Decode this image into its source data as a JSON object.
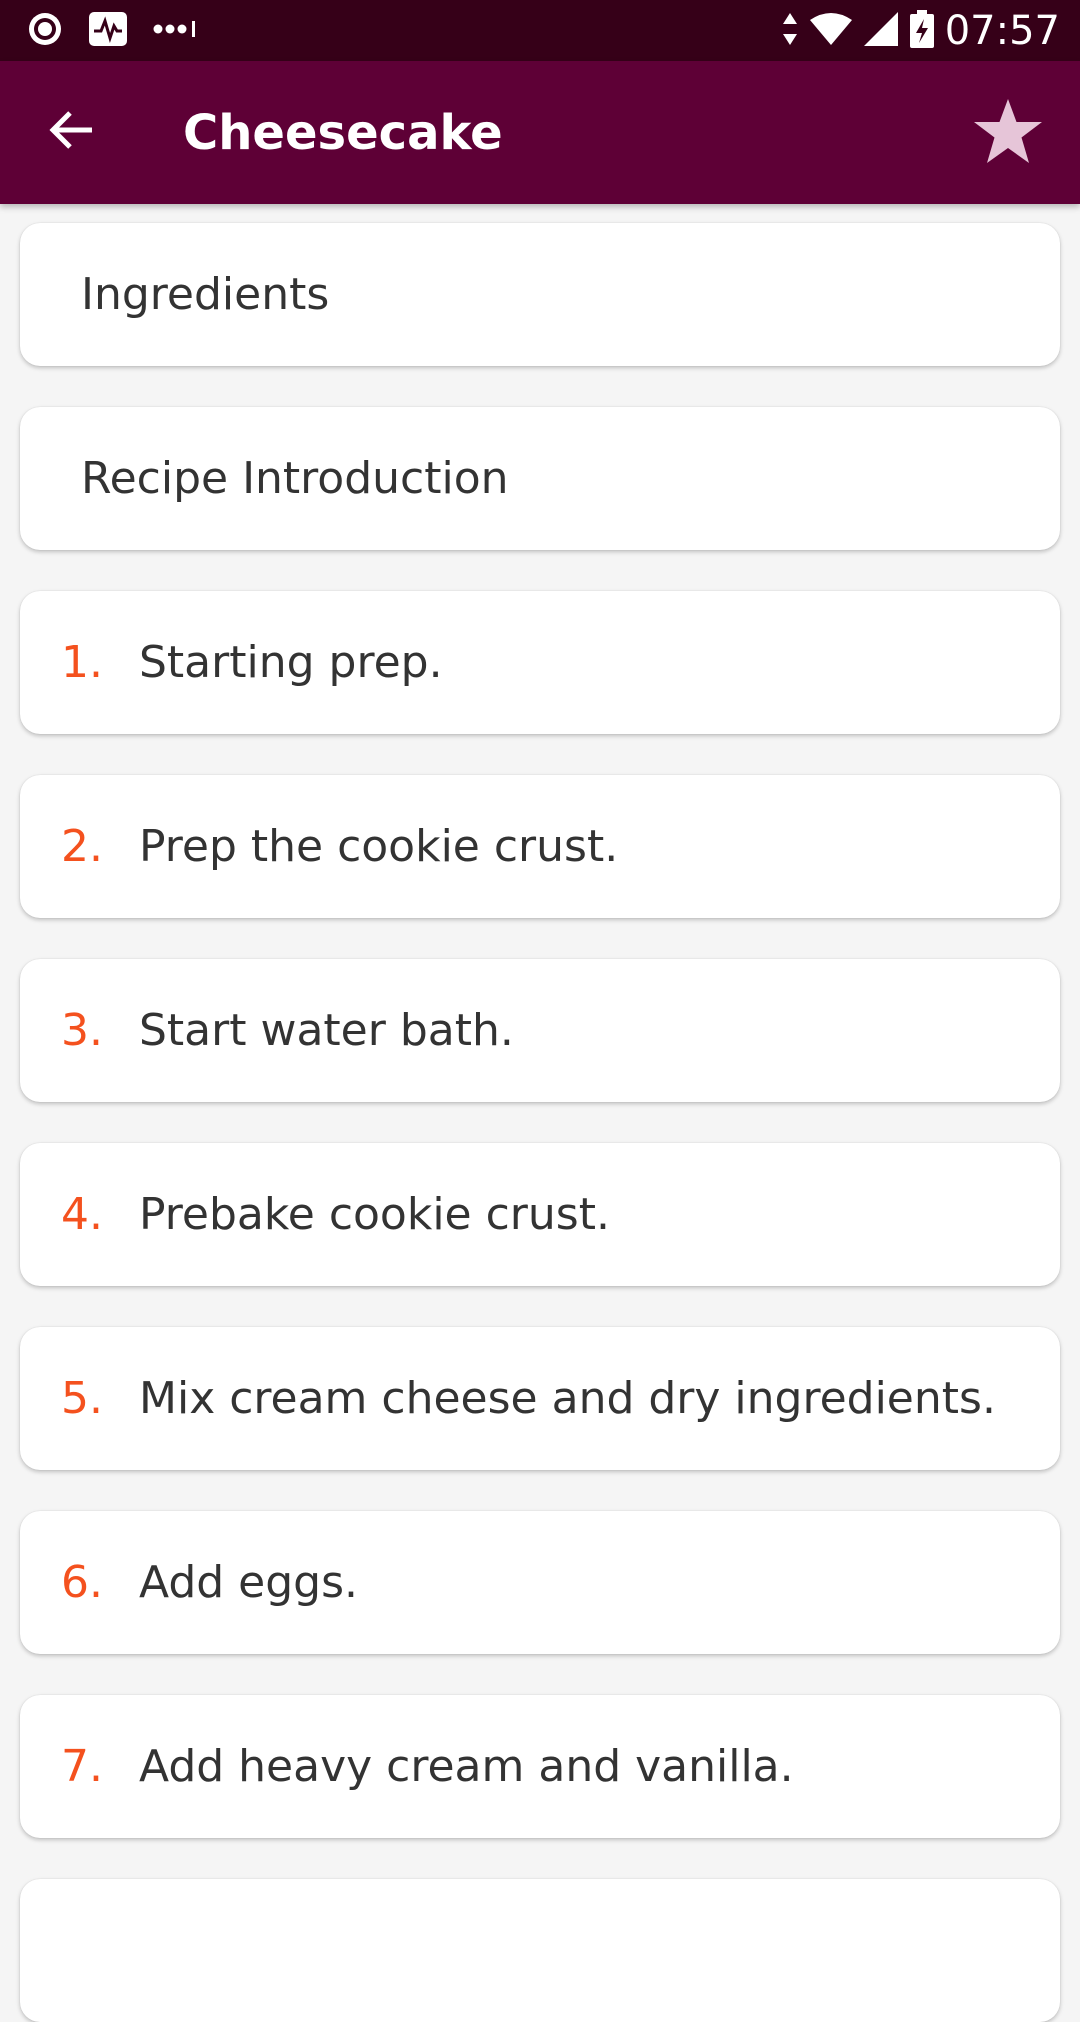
{
  "status_bar": {
    "time": "07:57",
    "left_icons": [
      "record-icon",
      "activity-monitor-icon",
      "more-dots-icon"
    ],
    "right_icons": [
      "data-arrows-icon",
      "wifi-icon",
      "cell-signal-icon",
      "battery-charging-icon"
    ]
  },
  "app_bar": {
    "title": "Cheesecake",
    "back_icon": "arrow-left-icon",
    "favorite_icon": "star-icon",
    "background_color": "#5e0036"
  },
  "sections": [
    {
      "label": "Ingredients"
    },
    {
      "label": "Recipe Introduction"
    }
  ],
  "steps": [
    {
      "number": "1.",
      "label": "Starting prep."
    },
    {
      "number": "2.",
      "label": "Prep the cookie crust."
    },
    {
      "number": "3.",
      "label": "Start water bath."
    },
    {
      "number": "4.",
      "label": "Prebake cookie crust."
    },
    {
      "number": "5.",
      "label": "Mix cream cheese and dry ingredients."
    },
    {
      "number": "6.",
      "label": "Add eggs."
    },
    {
      "number": "7.",
      "label": "Add heavy cream and vanilla."
    },
    {
      "number": "",
      "label": ""
    }
  ],
  "colors": {
    "status_bar": "#360018",
    "step_number": "#f4511e",
    "text": "#333333",
    "background": "#f5f5f5"
  }
}
